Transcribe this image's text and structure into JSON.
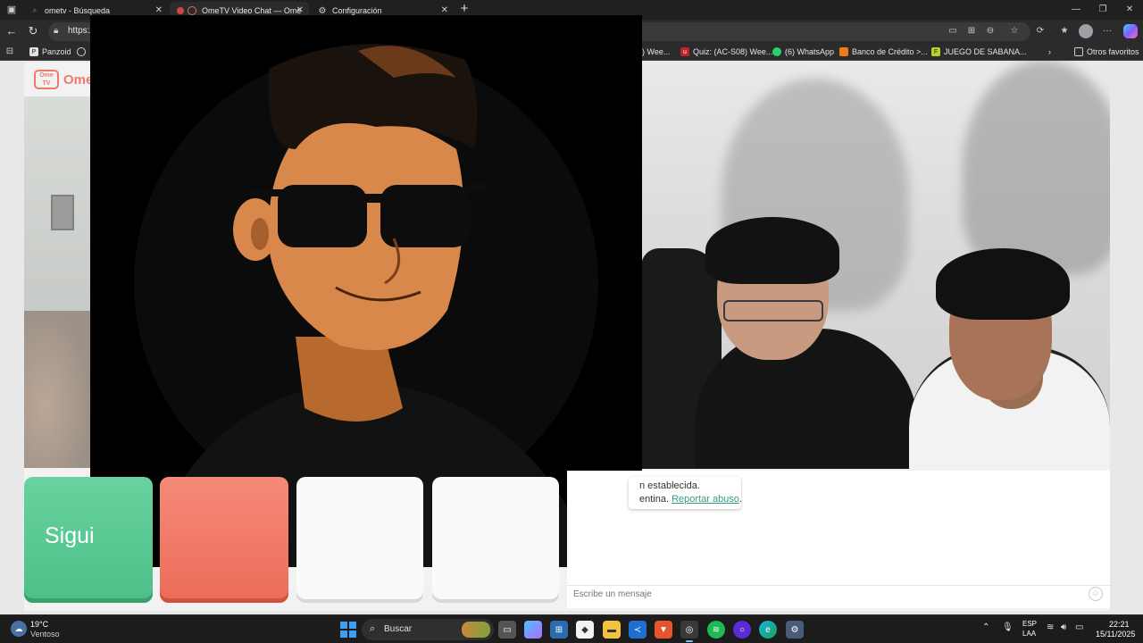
{
  "browser": {
    "tabs": [
      {
        "title": "ometv - Búsqueda",
        "icon": "search-icon"
      },
      {
        "title": "OmeTV Video Chat — Ome",
        "icon": "ometv-icon"
      },
      {
        "title": "Configuración",
        "icon": "gear-icon"
      }
    ],
    "address_url": "https:/",
    "bookmarks": [
      {
        "label": "Panzoid",
        "color": "#e0e0e0"
      },
      {
        "label": ") Wee...",
        "color": "#555555"
      },
      {
        "label": "Quiz: (AC-S08) Wee...",
        "color": "#c0202a"
      },
      {
        "label": "(6) WhatsApp",
        "color": "#25d366"
      },
      {
        "label": "Banco de Crédito >...",
        "color": "#f07a1a"
      },
      {
        "label": "JUEGO DE SABANA...",
        "color": "#b6d12a"
      },
      {
        "label": "Otros favoritos",
        "color": "#cfcfcf"
      }
    ]
  },
  "site": {
    "logo_text": "Ome",
    "logo_box": "Ome TV"
  },
  "controls": {
    "next_label": "Sigui"
  },
  "chat": {
    "line1": "n establecida.",
    "line2_prefix": "entina.",
    "report_link": "Reportar abuso",
    "line2_suffix": ".",
    "input_placeholder": "Escribe un mensaje"
  },
  "taskbar": {
    "temperature": "19°C",
    "weather": "Ventoso",
    "search_label": "Buscar",
    "lang_top": "ESP",
    "lang_bottom": "LAA",
    "time": "22:21",
    "date": "15/11/2025"
  },
  "colors": {
    "next_button": "#4cbf87",
    "stop_button": "#ec6c58",
    "accent_link": "#3a9a8a",
    "brand": "#ef7a6a"
  }
}
